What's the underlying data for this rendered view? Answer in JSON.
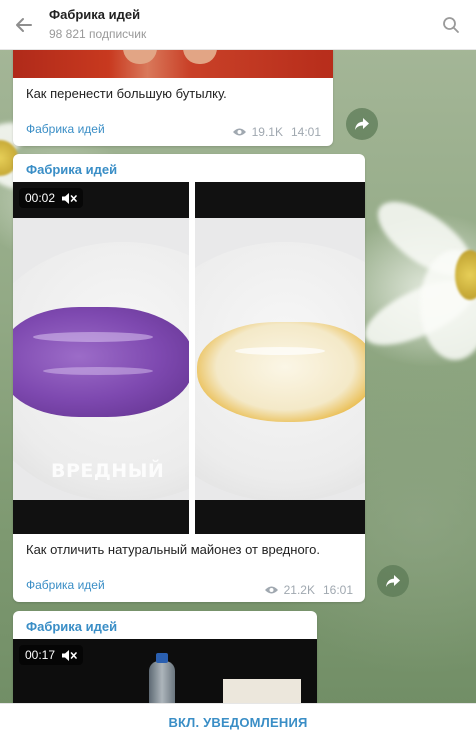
{
  "header": {
    "title": "Фабрика идей",
    "subscribers": "98 821 подписчик"
  },
  "messages": [
    {
      "text": "Как перенести большую бутылку.",
      "author": "Фабрика идей",
      "views": "19.1K",
      "time": "14:01"
    },
    {
      "author_top": "Фабрика идей",
      "video_duration": "00:02",
      "video_caption": "ВРЕДНЫЙ",
      "text": "Как отличить натуральный майонез от вредного.",
      "author": "Фабрика идей",
      "views": "21.2K",
      "time": "16:01"
    },
    {
      "author_top": "Фабрика идей",
      "video_duration": "00:17"
    }
  ],
  "bottom_bar": {
    "notify_label": "ВКЛ. УВЕДОМЛЕНИЯ"
  },
  "colors": {
    "accent": "#3a8ec6",
    "meta": "#a0a8b0"
  }
}
